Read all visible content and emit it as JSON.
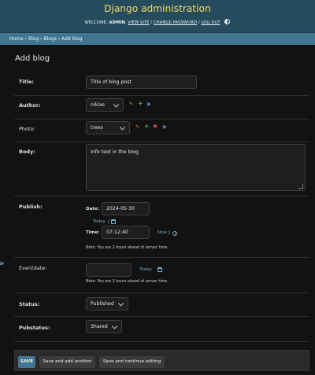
{
  "header": {
    "site_title": "Django administration",
    "welcome": "WELCOME,",
    "username": "ADMIN",
    "view_site": "VIEW SITE",
    "change_password": "CHANGE PASSWORD",
    "log_out": "LOG OUT",
    "separator": "/"
  },
  "breadcrumbs": {
    "home": "Home",
    "app": "Blog",
    "model": "Blogs",
    "current": "Add blog",
    "separator": "›"
  },
  "nav_toggle": "»",
  "page_title": "Add blog",
  "form": {
    "title": {
      "label": "Title:",
      "value": "Title of blog post"
    },
    "author": {
      "label": "Author:",
      "value": "niklas"
    },
    "photo": {
      "label": "Photo:",
      "value": "trees"
    },
    "body": {
      "label": "Body:",
      "value": "Info text in the blog"
    },
    "publish": {
      "label": "Publish:",
      "date_label": "Date:",
      "date_value": "2024-05-30",
      "today_link": "Today",
      "time_label": "Time:",
      "time_value": "07:12:40",
      "now_link": "Now",
      "pipe": "|",
      "help": "Note: You are 2 hours ahead of server time."
    },
    "eventdate": {
      "label": "Eventdate:",
      "value": "",
      "today_link": "Today",
      "help": "Note: You are 2 hours ahead of server time."
    },
    "status": {
      "label": "Status:",
      "value": "Published"
    },
    "pubstatus": {
      "label": "Pubstatus:",
      "value": "Shared"
    }
  },
  "submit": {
    "save": "SAVE",
    "save_add_another": "Save and add another",
    "save_continue": "Save and continue editing"
  },
  "colors": {
    "header_bg": "#264b5d",
    "breadcrumb_bg": "#417690",
    "site_title": "#f5dd5d",
    "link": "#79aec8",
    "page_bg": "#121212"
  },
  "icons": [
    "pencil-icon",
    "plus-icon",
    "eye-icon",
    "cross-icon",
    "calendar-icon",
    "clock-icon",
    "theme-toggle-icon"
  ]
}
